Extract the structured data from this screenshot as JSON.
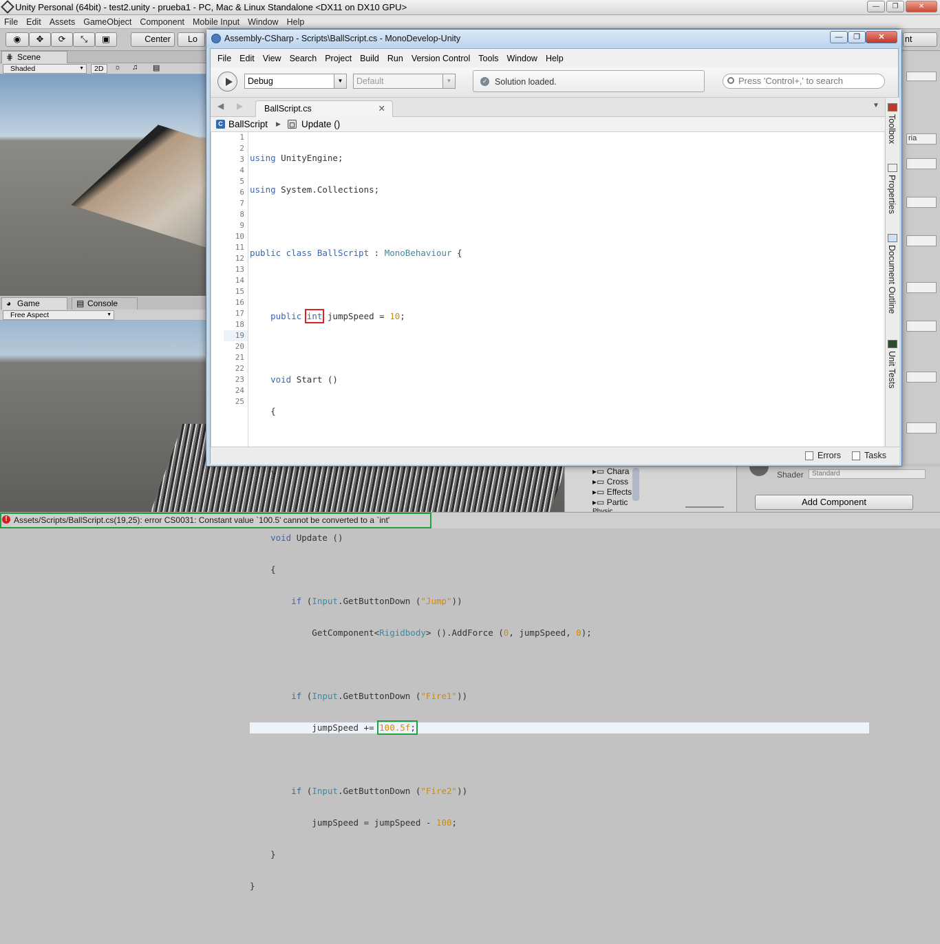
{
  "unity": {
    "title": "Unity Personal (64bit) - test2.unity - prueba1 - PC, Mac & Linux Standalone <DX11 on DX10 GPU>",
    "menu": [
      "File",
      "Edit",
      "Assets",
      "GameObject",
      "Component",
      "Mobile Input",
      "Window",
      "Help"
    ],
    "toolbar": {
      "pivot": "Center",
      "space": "Lo",
      "layout": "nt"
    },
    "scene_tab": "Scene",
    "scene_shading": "Shaded",
    "scene_2d": "2D",
    "game_tab": "Game",
    "console_tab": "Console",
    "game_aspect": "Free Aspect",
    "hierarchy_items": [
      "Chara",
      "Cross",
      "Effects",
      "Partic",
      "Physic"
    ],
    "inspector": {
      "side_label": "ria",
      "shader_label": "Shader",
      "shader_value": "Standard",
      "add_component": "Add Component"
    },
    "status_error": "Assets/Scripts/BallScript.cs(19,25): error CS0031: Constant value `100.5' cannot be converted to a `int'"
  },
  "monodevelop": {
    "title": "Assembly-CSharp - Scripts\\BallScript.cs - MonoDevelop-Unity",
    "menu": [
      "File",
      "Edit",
      "View",
      "Search",
      "Project",
      "Build",
      "Run",
      "Version Control",
      "Tools",
      "Window",
      "Help"
    ],
    "config": "Debug",
    "platform": "Default",
    "status": "Solution loaded.",
    "search_placeholder": "Press 'Control+,' to search",
    "tab": "BallScript.cs",
    "breadcrumb_class": "BallScript",
    "breadcrumb_member": "Update ()",
    "side_pads": [
      "Toolbox",
      "Properties",
      "Document Outline",
      "Unit Tests"
    ],
    "bottom": {
      "errors": "Errors",
      "tasks": "Tasks"
    },
    "line_numbers": [
      "1",
      "2",
      "3",
      "4",
      "5",
      "6",
      "7",
      "8",
      "9",
      "10",
      "11",
      "12",
      "13",
      "14",
      "15",
      "16",
      "17",
      "18",
      "19",
      "20",
      "21",
      "22",
      "23",
      "24",
      "25"
    ],
    "code": {
      "l1a": "using",
      "l1b": " UnityEngine;",
      "l2a": "using",
      "l2b": " System.Collections;",
      "l4a": "public class",
      "l4b": " BallScript",
      "l4c": " : ",
      "l4d": "MonoBehaviour",
      "l4e": " {",
      "l6a": "    public ",
      "l6b": "int",
      "l6c": " jumpSpeed = ",
      "l6d": "10",
      "l6e": ";",
      "l8a": "    void",
      "l8b": " Start ()",
      "l9": "    {",
      "l11": "    }",
      "l13a": "    void",
      "l13b": " Update ()",
      "l14": "    {",
      "l15a": "        if",
      "l15b": " (",
      "l15c": "Input",
      "l15d": ".GetButtonDown (",
      "l15e": "\"Jump\"",
      "l15f": "))",
      "l16a": "            GetComponent<",
      "l16b": "Rigidbody",
      "l16c": "> ().AddForce (",
      "l16d": "0",
      "l16e": ", jumpSpeed, ",
      "l16f": "0",
      "l16g": ");",
      "l18a": "        if",
      "l18b": " (",
      "l18c": "Input",
      "l18d": ".GetButtonDown (",
      "l18e": "\"Fire1\"",
      "l18f": "))",
      "l19a": "            jumpSpeed += ",
      "l19b": "100.5f",
      "l19c": ";",
      "l21a": "        if",
      "l21b": " (",
      "l21c": "Input",
      "l21d": ".GetButtonDown (",
      "l21e": "\"Fire2\"",
      "l21f": "))",
      "l22a": "            jumpSpeed = jumpSpeed - ",
      "l22b": "100",
      "l22c": ";",
      "l23": "    }",
      "l24": "}"
    }
  },
  "colors": {
    "keyword": "#3a65b8",
    "type": "#3a8aa6",
    "literal": "#d68a00",
    "error_outline": "#d22222",
    "fix_outline": "#20a040"
  }
}
